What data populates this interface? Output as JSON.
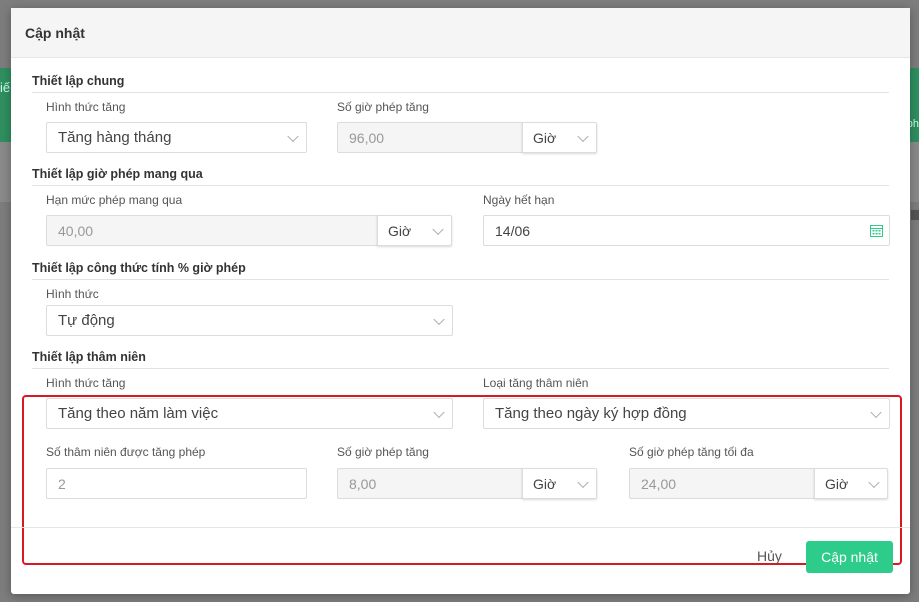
{
  "background": {
    "left_text": "iế",
    "right_text": "ph"
  },
  "modal": {
    "title": "Cập nhật"
  },
  "general": {
    "title": "Thiết lập chung",
    "increase_type_label": "Hình thức tăng",
    "increase_type_value": "Tăng hàng tháng",
    "hours_label": "Số giờ phép tăng",
    "hours_value": "96,00",
    "hours_unit": "Giờ"
  },
  "carry": {
    "title": "Thiết lập giờ phép mang qua",
    "limit_label": "Hạn mức phép mang qua",
    "limit_value": "40,00",
    "limit_unit": "Giờ",
    "expiry_label": "Ngày hết hạn",
    "expiry_value": "14/06"
  },
  "formula": {
    "title": "Thiết lập công thức tính % giờ phép",
    "type_label": "Hình thức",
    "type_value": "Tự động"
  },
  "seniority": {
    "title": "Thiết lập thâm niên",
    "increase_type_label": "Hình thức tăng",
    "increase_type_value": "Tăng theo năm làm việc",
    "seniority_type_label": "Loại tăng thâm niên",
    "seniority_type_value": "Tăng theo ngày ký hợp đồng",
    "years_label": "Số thâm niên được tăng phép",
    "years_value": "2",
    "hours_label": "Số giờ phép tăng",
    "hours_value": "8,00",
    "hours_unit": "Giờ",
    "max_hours_label": "Số giờ phép tăng tối đa",
    "max_hours_value": "24,00",
    "max_hours_unit": "Giờ"
  },
  "footer": {
    "cancel_label": "Hủy",
    "submit_label": "Cập nhật"
  },
  "colors": {
    "accent": "#2ecc8a",
    "highlight_border": "#d8191f",
    "calendar_icon": "#2ecc8a"
  }
}
